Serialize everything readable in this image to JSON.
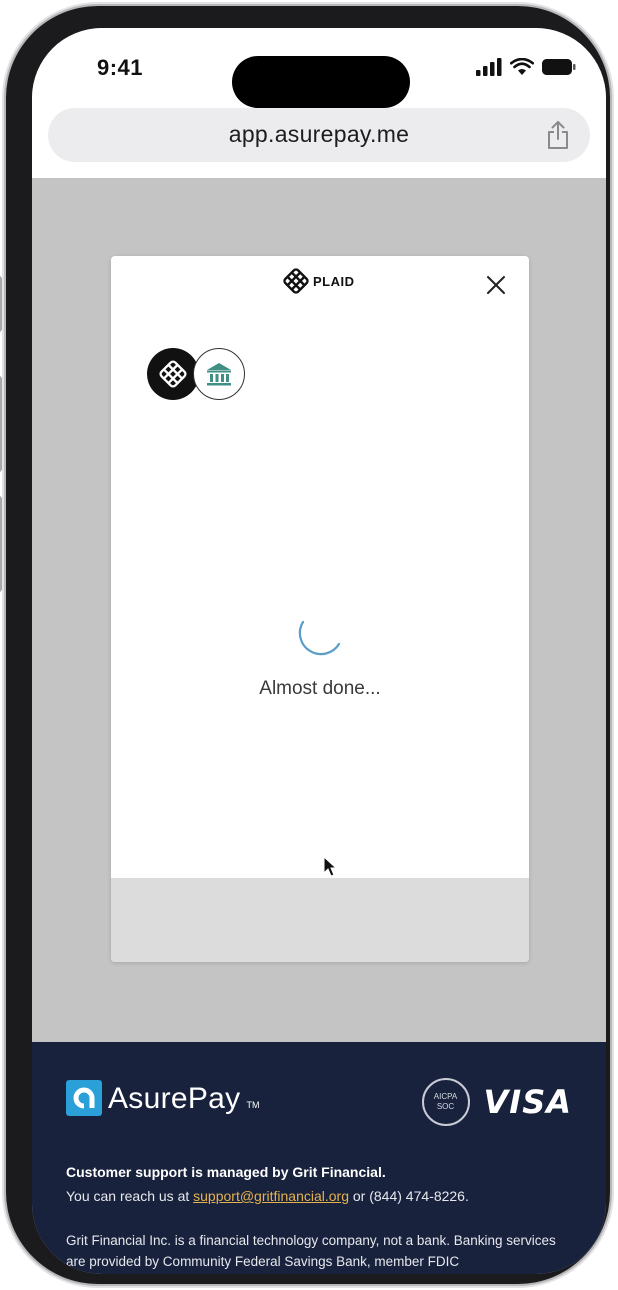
{
  "status_bar": {
    "time": "9:41"
  },
  "browser": {
    "url": "app.asurepay.me",
    "share_icon": "share-icon"
  },
  "plaid_modal": {
    "logo_text": "PLAID",
    "close_icon": "close-icon",
    "institution_icon": "bank-icon",
    "loading_text": "Almost done..."
  },
  "footer": {
    "brand_name": "AsurePay",
    "brand_tm": "TM",
    "aicpa_line1": "AICPA",
    "aicpa_line2": "SOC",
    "visa": "VISA",
    "support_heading": "Customer support is managed by Grit Financial.",
    "support_prefix": "You can reach us at ",
    "support_email": "support@gritfinancial.org",
    "support_suffix": " or (844) 474-8226.",
    "disclaimer": "Grit Financial Inc. is a financial technology company, not a bank. Banking services are provided by Community Federal Savings Bank, member FDIC"
  },
  "colors": {
    "footer_bg": "#19223c",
    "link": "#e5b24f",
    "overlay": "#c4c4c4",
    "spinner": "#5a9ec8",
    "bank_icon": "#3f8f86"
  }
}
